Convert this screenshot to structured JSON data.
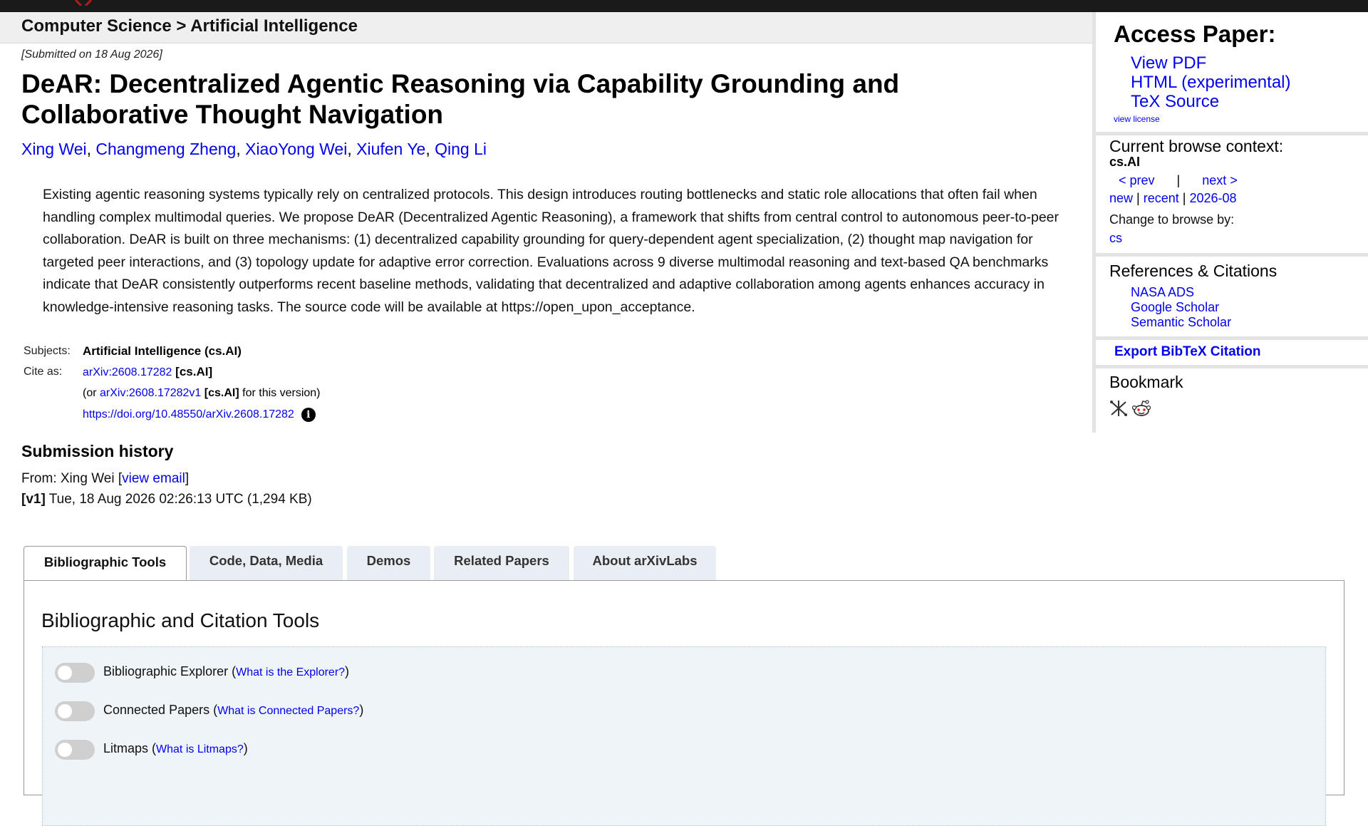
{
  "breadcrumb": "Computer Science > Artificial Intelligence",
  "submitted": "[Submitted on 18 Aug 2026]",
  "title": "DeAR: Decentralized Agentic Reasoning via Capability Grounding and Collaborative Thought Navigation",
  "authors": [
    "Xing Wei",
    "Changmeng Zheng",
    "XiaoYong Wei",
    "Xiufen Ye",
    "Qing Li"
  ],
  "author_sep": ", ",
  "abstract": "Existing agentic reasoning systems typically rely on centralized protocols. This design introduces routing bottlenecks and static role allocations that often fail when handling complex multimodal queries. We propose DeAR (Decentralized Agentic Reasoning), a framework that shifts from central control to autonomous peer-to-peer collaboration. DeAR is built on three mechanisms: (1) decentralized capability grounding for query-dependent agent specialization, (2) thought map navigation for targeted peer interactions, and (3) topology update for adaptive error correction. Evaluations across 9 diverse multimodal reasoning and text-based QA benchmarks indicate that DeAR consistently outperforms recent baseline methods, validating that decentralized and adaptive collaboration among agents enhances accuracy in knowledge-intensive reasoning tasks. The source code will be available at https://open_upon_acceptance.",
  "meta": {
    "subjects_label": "Subjects:",
    "subjects_value": "Artificial Intelligence (cs.AI)",
    "cite_label": "Cite as:",
    "cite_id": "arXiv:2608.17282",
    "cite_cat": "[cs.AI]",
    "version_prefix": "(or ",
    "version_id": "arXiv:2608.17282v1",
    "version_cat": "[cs.AI]",
    "version_suffix": " for this version)",
    "doi": "https://doi.org/10.48550/arXiv.2608.17282",
    "info_glyph": "i"
  },
  "history": {
    "title": "Submission history",
    "from_prefix": "From: Xing Wei [",
    "view_email": "view email",
    "from_suffix": "]",
    "v1_label": "[v1]",
    "v1_text": " Tue, 18 Aug 2026 02:26:13 UTC (1,294 KB)"
  },
  "tabs": [
    "Bibliographic Tools",
    "Code, Data, Media",
    "Demos",
    "Related Papers",
    "About arXivLabs"
  ],
  "panel": {
    "heading": "Bibliographic and Citation Tools",
    "toggles": [
      {
        "label": "Bibliographic Explorer (",
        "link": "What is the Explorer?",
        "suffix": ")"
      },
      {
        "label": "Connected Papers (",
        "link": "What is Connected Papers?",
        "suffix": ")"
      },
      {
        "label": "Litmaps (",
        "link": "What is Litmaps?",
        "suffix": ")"
      }
    ]
  },
  "sidebar": {
    "access_title": "Access Paper:",
    "access_links": [
      "View PDF",
      "HTML (experimental)",
      "TeX Source"
    ],
    "view_license": "view license",
    "context_title": "Current browse context:",
    "context_value": "cs.AI",
    "prev": "< prev",
    "pipe": "|",
    "next": "next >",
    "new": "new",
    "recent": "recent",
    "month": "2026-08",
    "change_by": "Change to browse by:",
    "cs": "cs",
    "refs_title": "References & Citations",
    "refs_links": [
      "NASA ADS",
      "Google Scholar",
      "Semantic Scholar"
    ],
    "export": "Export BibTeX Citation",
    "bookmark_title": "Bookmark",
    "bookmark_icons": [
      "bibsonomy-icon",
      "reddit-icon"
    ]
  },
  "colors": {
    "link": "#0000ee",
    "topbar": "#1a1a1a",
    "logo": "#b31b1b",
    "toolbox_bg": "#eef4f8"
  }
}
